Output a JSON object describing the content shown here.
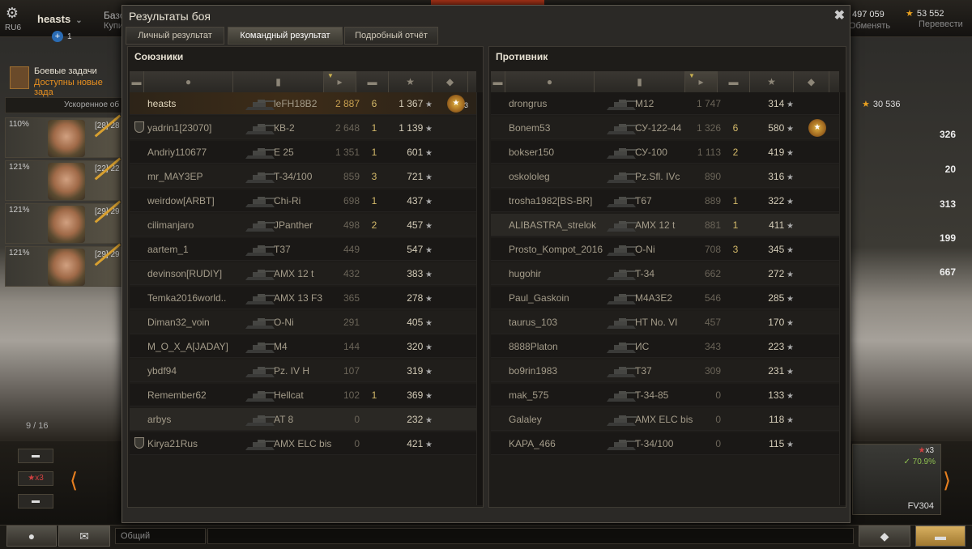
{
  "topbar": {
    "region": "RU6",
    "player_name": "heasts",
    "invites_count": "1",
    "bazaar_label": "Базо",
    "buy_label": "Купи",
    "credits": "497 059",
    "credits_label": "Обменять",
    "gold": "53 552",
    "gold_label": "Перевести"
  },
  "missions": {
    "title": "Боевые задачи",
    "subtitle": "Доступны новые зада"
  },
  "accelerate_label": "Ускоренное об",
  "crew": [
    {
      "pct": "110%",
      "lvl": "[28] 28"
    },
    {
      "pct": "121%",
      "lvl": "[22] 22"
    },
    {
      "pct": "121%",
      "lvl": "[29] 29"
    },
    {
      "pct": "121%",
      "lvl": "[29] 29"
    }
  ],
  "right_stats": [
    "326",
    "20",
    "313",
    "199",
    "667"
  ],
  "right_gold_stat": "30 536",
  "carousel_progress": "9 / 16",
  "carousel": {
    "x3_badge": "x3",
    "vehicle_name": "FV304",
    "vehicle_pct": "70.9%",
    "vehicle_x3": "x3"
  },
  "footer": {
    "chat_channel": "Общий"
  },
  "window": {
    "title": "Результаты боя",
    "tabs": [
      {
        "label": "Личный результат",
        "active": false
      },
      {
        "label": "Командный результат",
        "active": true
      },
      {
        "label": "Подробный отчёт",
        "active": false
      }
    ],
    "allies": {
      "title": "Союзники",
      "rows": [
        {
          "nick": "heasts",
          "tank": "leFH18B2",
          "damage": "2 887",
          "kills": "6",
          "xp": "1 367",
          "medal": true,
          "medal_count": "3",
          "me": true,
          "platoon": false
        },
        {
          "nick": "yadrin1[23070]",
          "tank": "КВ-2",
          "damage": "2 648",
          "kills": "1",
          "xp": "1 139",
          "platoon": true
        },
        {
          "nick": "Andriy110677",
          "tank": "E 25",
          "damage": "1 351",
          "kills": "1",
          "xp": "601"
        },
        {
          "nick": "mr_MAY3EP",
          "tank": "T-34/100",
          "damage": "859",
          "kills": "3",
          "xp": "721"
        },
        {
          "nick": "weirdow[ARBT]",
          "tank": "Chi-Ri",
          "damage": "698",
          "kills": "1",
          "xp": "437"
        },
        {
          "nick": "cilimanjaro",
          "tank": "JPanther",
          "damage": "498",
          "kills": "2",
          "xp": "457"
        },
        {
          "nick": "aartem_1",
          "tank": "T37",
          "damage": "449",
          "kills": "",
          "xp": "547"
        },
        {
          "nick": "devinson[RUDIY]",
          "tank": "AMX 12 t",
          "damage": "432",
          "kills": "",
          "xp": "383"
        },
        {
          "nick": "Temka2016world..",
          "tank": "AMX 13 F3",
          "damage": "365",
          "kills": "",
          "xp": "278"
        },
        {
          "nick": "Diman32_voin",
          "tank": "O-Ni",
          "damage": "291",
          "kills": "",
          "xp": "405"
        },
        {
          "nick": "M_O_X_A[JADAY]",
          "tank": "M4",
          "damage": "144",
          "kills": "",
          "xp": "320"
        },
        {
          "nick": "ybdf94",
          "tank": "Pz. IV H",
          "damage": "107",
          "kills": "",
          "xp": "319"
        },
        {
          "nick": "Remember62",
          "tank": "Hellcat",
          "damage": "102",
          "kills": "1",
          "xp": "369"
        },
        {
          "nick": "arbys",
          "tank": "AT 8",
          "damage": "0",
          "kills": "",
          "xp": "232",
          "highlight": true
        },
        {
          "nick": "Kirya21Rus",
          "tank": "AMX ELC bis",
          "damage": "0",
          "kills": "",
          "xp": "421",
          "platoon": true
        }
      ]
    },
    "enemies": {
      "title": "Противник",
      "rows": [
        {
          "nick": "drongrus",
          "tank": "M12",
          "damage": "1 747",
          "kills": "",
          "xp": "314"
        },
        {
          "nick": "Bonem53",
          "tank": "СУ-122-44",
          "damage": "1 326",
          "kills": "6",
          "xp": "580",
          "medal": true
        },
        {
          "nick": "bokser150",
          "tank": "СУ-100",
          "damage": "1 113",
          "kills": "2",
          "xp": "419"
        },
        {
          "nick": "oskololeg",
          "tank": "Pz.Sfl. IVc",
          "damage": "890",
          "kills": "",
          "xp": "316"
        },
        {
          "nick": "trosha1982[BS-BR]",
          "tank": "T67",
          "damage": "889",
          "kills": "1",
          "xp": "322"
        },
        {
          "nick": "ALIBASTRA_strelok",
          "tank": "AMX 12 t",
          "damage": "881",
          "kills": "1",
          "xp": "411",
          "hover": true
        },
        {
          "nick": "Prosto_Kompot_2016",
          "tank": "O-Ni",
          "damage": "708",
          "kills": "3",
          "xp": "345"
        },
        {
          "nick": "hugohir",
          "tank": "T-34",
          "damage": "662",
          "kills": "",
          "xp": "272"
        },
        {
          "nick": "Paul_Gaskoin",
          "tank": "M4A3E2",
          "damage": "546",
          "kills": "",
          "xp": "285"
        },
        {
          "nick": "taurus_103",
          "tank": "HT No. VI",
          "damage": "457",
          "kills": "",
          "xp": "170"
        },
        {
          "nick": "8888Platon",
          "tank": "ИС",
          "damage": "343",
          "kills": "",
          "xp": "223"
        },
        {
          "nick": "bo9rin1983",
          "tank": "T37",
          "damage": "309",
          "kills": "",
          "xp": "231"
        },
        {
          "nick": "mak_575",
          "tank": "T-34-85",
          "damage": "0",
          "kills": "",
          "xp": "133"
        },
        {
          "nick": "Galaley",
          "tank": "AMX ELC bis",
          "damage": "0",
          "kills": "",
          "xp": "118"
        },
        {
          "nick": "KAPA_466",
          "tank": "T-34/100",
          "damage": "0",
          "kills": "",
          "xp": "115"
        }
      ]
    }
  }
}
